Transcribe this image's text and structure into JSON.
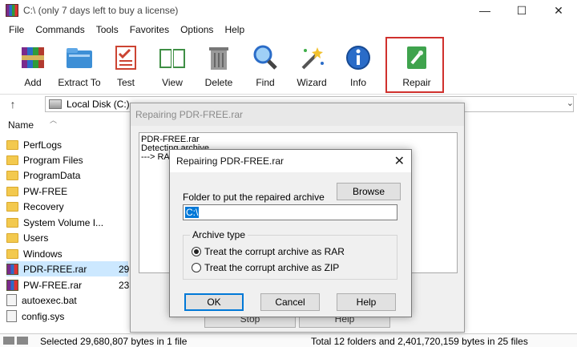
{
  "window": {
    "title": "C:\\ (only 7 days left to buy a license)",
    "controls": {
      "minimize": "—",
      "maximize": "☐",
      "close": "✕"
    }
  },
  "menu": [
    "File",
    "Commands",
    "Tools",
    "Favorites",
    "Options",
    "Help"
  ],
  "toolbar": {
    "items": [
      {
        "label": "Add",
        "icon": "archive-add-icon"
      },
      {
        "label": "Extract To",
        "icon": "folder-extract-icon"
      },
      {
        "label": "Test",
        "icon": "checklist-icon"
      },
      {
        "label": "View",
        "icon": "book-icon"
      },
      {
        "label": "Delete",
        "icon": "trash-icon"
      },
      {
        "label": "Find",
        "icon": "magnifier-icon"
      },
      {
        "label": "Wizard",
        "icon": "magic-wand-icon"
      },
      {
        "label": "Info",
        "icon": "info-icon"
      }
    ],
    "repair": {
      "label": "Repair",
      "icon": "repair-icon",
      "highlight_color": "#d0312d"
    }
  },
  "address": {
    "up": "↑",
    "path": "Local Disk (C:)",
    "dropdown": "⌄"
  },
  "filelist": {
    "column_name": "Name",
    "rows": [
      {
        "name": "PerfLogs",
        "type": "folder",
        "size": ""
      },
      {
        "name": "Program Files",
        "type": "folder",
        "size": ""
      },
      {
        "name": "ProgramData",
        "type": "folder",
        "size": ""
      },
      {
        "name": "PW-FREE",
        "type": "folder",
        "size": ""
      },
      {
        "name": "Recovery",
        "type": "folder",
        "size": ""
      },
      {
        "name": "System Volume I...",
        "type": "folder",
        "size": ""
      },
      {
        "name": "Users",
        "type": "folder",
        "size": ""
      },
      {
        "name": "Windows",
        "type": "folder",
        "size": ""
      },
      {
        "name": "PDR-FREE.rar",
        "type": "rar",
        "size": "29",
        "selected": true
      },
      {
        "name": "PW-FREE.rar",
        "type": "rar",
        "size": "23"
      },
      {
        "name": "autoexec.bat",
        "type": "file",
        "size": ""
      },
      {
        "name": "config.sys",
        "type": "file",
        "size": ""
      }
    ]
  },
  "status": {
    "left": "Selected 29,680,807 bytes in 1 file",
    "right": "Total 12 folders and 2,401,720,159 bytes in 25 files"
  },
  "back_dialog": {
    "title": "Repairing PDR-FREE.rar",
    "log": [
      "PDR-FREE.rar",
      "Detecting archive",
      "---> RA"
    ],
    "buttons": [
      "Stop",
      "Help"
    ]
  },
  "dialog": {
    "title": "Repairing PDR-FREE.rar",
    "close": "✕",
    "folder_label": "Folder to put the repaired archive",
    "browse": "Browse",
    "folder_value": "C:\\",
    "archive_type_label": "Archive type",
    "options": [
      {
        "label": "Treat the corrupt archive as RAR",
        "checked": true
      },
      {
        "label": "Treat the corrupt archive as ZIP",
        "checked": false
      }
    ],
    "ok": "OK",
    "cancel": "Cancel",
    "help": "Help",
    "accent_color": "#0078d7"
  }
}
